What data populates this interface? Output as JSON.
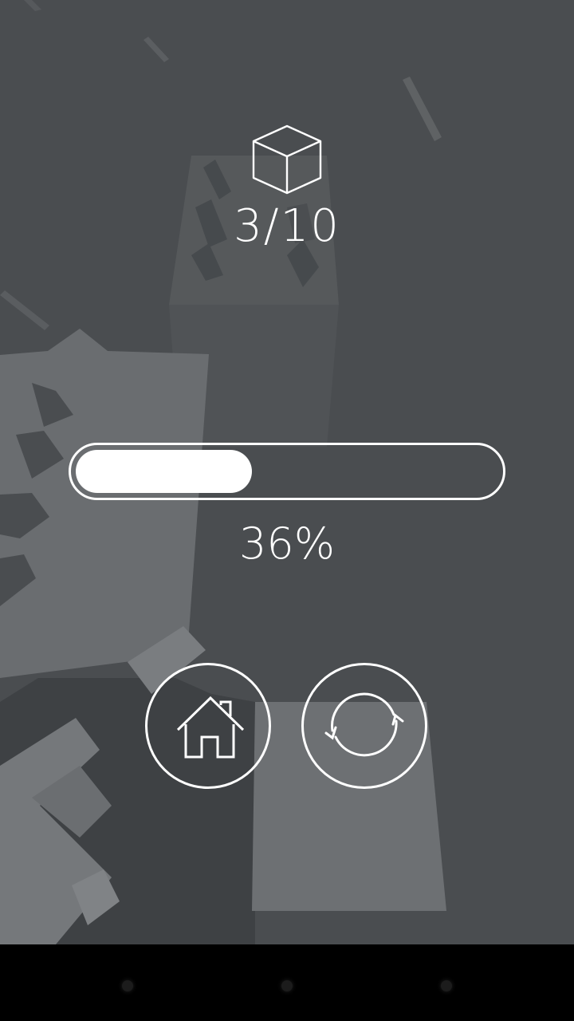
{
  "level": {
    "text": "3/10",
    "icon": "cube-icon"
  },
  "progress": {
    "value_percent": 36,
    "text": "36%"
  },
  "buttons": {
    "home": {
      "icon": "home-icon"
    },
    "restart": {
      "icon": "restart-icon"
    }
  },
  "navbar": {
    "buttons": [
      "back",
      "home",
      "recents"
    ]
  },
  "colors": {
    "background": "#4a4d50",
    "ui": "#ffffff",
    "navbar": "#000000"
  }
}
